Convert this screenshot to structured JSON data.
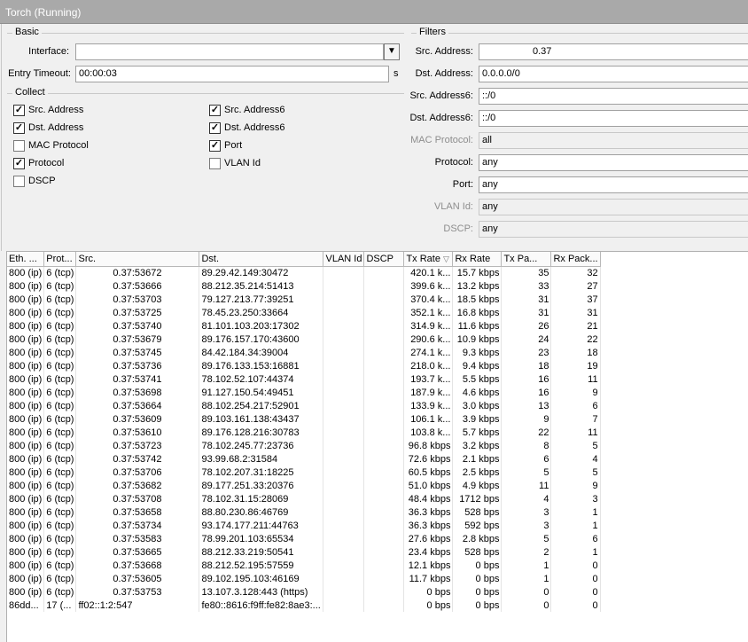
{
  "window": {
    "title": "Torch (Running)"
  },
  "basic": {
    "title": "Basic",
    "interface_label": "Interface:",
    "interface_value": "",
    "entry_timeout_label": "Entry Timeout:",
    "entry_timeout_value": "00:00:03",
    "entry_timeout_unit": "s"
  },
  "collect": {
    "title": "Collect",
    "items": [
      {
        "label": "Src. Address",
        "checked": true
      },
      {
        "label": "Src. Address6",
        "checked": true
      },
      {
        "label": "Dst. Address",
        "checked": true
      },
      {
        "label": "Dst. Address6",
        "checked": true
      },
      {
        "label": "MAC Protocol",
        "checked": false
      },
      {
        "label": "Port",
        "checked": true
      },
      {
        "label": "Protocol",
        "checked": true
      },
      {
        "label": "VLAN Id",
        "checked": false
      },
      {
        "label": "DSCP",
        "checked": false
      }
    ]
  },
  "filters": {
    "title": "Filters",
    "src_address_label": "Src. Address:",
    "src_address_value": "0.37",
    "dst_address_label": "Dst. Address:",
    "dst_address_value": "0.0.0.0/0",
    "src_address6_label": "Src. Address6:",
    "src_address6_value": "::/0",
    "dst_address6_label": "Dst. Address6:",
    "dst_address6_value": "::/0",
    "mac_protocol_label": "MAC Protocol:",
    "mac_protocol_value": "all",
    "protocol_label": "Protocol:",
    "protocol_value": "any",
    "port_label": "Port:",
    "port_value": "any",
    "vlan_id_label": "VLAN Id:",
    "vlan_id_value": "any",
    "dscp_label": "DSCP:",
    "dscp_value": "any"
  },
  "table": {
    "columns": [
      "Eth. ...",
      "Prot...",
      "Src.",
      "Dst.",
      "VLAN Id",
      "DSCP",
      "Tx Rate",
      "Rx Rate",
      "Tx Pa...",
      "Rx Pack..."
    ],
    "sort_icon": "sort-desc-icon",
    "rows": [
      [
        "800 (ip)",
        "6 (tcp)",
        "0.37:53672",
        "89.29.42.149:30472",
        "",
        "",
        "420.1 k...",
        "15.7 kbps",
        "35",
        "32"
      ],
      [
        "800 (ip)",
        "6 (tcp)",
        "0.37:53666",
        "88.212.35.214:51413",
        "",
        "",
        "399.6 k...",
        "13.2 kbps",
        "33",
        "27"
      ],
      [
        "800 (ip)",
        "6 (tcp)",
        "0.37:53703",
        "79.127.213.77:39251",
        "",
        "",
        "370.4 k...",
        "18.5 kbps",
        "31",
        "37"
      ],
      [
        "800 (ip)",
        "6 (tcp)",
        "0.37:53725",
        "78.45.23.250:33664",
        "",
        "",
        "352.1 k...",
        "16.8 kbps",
        "31",
        "31"
      ],
      [
        "800 (ip)",
        "6 (tcp)",
        "0.37:53740",
        "81.101.103.203:17302",
        "",
        "",
        "314.9 k...",
        "11.6 kbps",
        "26",
        "21"
      ],
      [
        "800 (ip)",
        "6 (tcp)",
        "0.37:53679",
        "89.176.157.170:43600",
        "",
        "",
        "290.6 k...",
        "10.9 kbps",
        "24",
        "22"
      ],
      [
        "800 (ip)",
        "6 (tcp)",
        "0.37:53745",
        "84.42.184.34:39004",
        "",
        "",
        "274.1 k...",
        "9.3 kbps",
        "23",
        "18"
      ],
      [
        "800 (ip)",
        "6 (tcp)",
        "0.37:53736",
        "89.176.133.153:16881",
        "",
        "",
        "218.0 k...",
        "9.4 kbps",
        "18",
        "19"
      ],
      [
        "800 (ip)",
        "6 (tcp)",
        "0.37:53741",
        "78.102.52.107:44374",
        "",
        "",
        "193.7 k...",
        "5.5 kbps",
        "16",
        "11"
      ],
      [
        "800 (ip)",
        "6 (tcp)",
        "0.37:53698",
        "91.127.150.54:49451",
        "",
        "",
        "187.9 k...",
        "4.6 kbps",
        "16",
        "9"
      ],
      [
        "800 (ip)",
        "6 (tcp)",
        "0.37:53664",
        "88.102.254.217:52901",
        "",
        "",
        "133.9 k...",
        "3.0 kbps",
        "13",
        "6"
      ],
      [
        "800 (ip)",
        "6 (tcp)",
        "0.37:53609",
        "89.103.161.138:43437",
        "",
        "",
        "106.1 k...",
        "3.9 kbps",
        "9",
        "7"
      ],
      [
        "800 (ip)",
        "6 (tcp)",
        "0.37:53610",
        "89.176.128.216:30783",
        "",
        "",
        "103.8 k...",
        "5.7 kbps",
        "22",
        "11"
      ],
      [
        "800 (ip)",
        "6 (tcp)",
        "0.37:53723",
        "78.102.245.77:23736",
        "",
        "",
        "96.8 kbps",
        "3.2 kbps",
        "8",
        "5"
      ],
      [
        "800 (ip)",
        "6 (tcp)",
        "0.37:53742",
        "93.99.68.2:31584",
        "",
        "",
        "72.6 kbps",
        "2.1 kbps",
        "6",
        "4"
      ],
      [
        "800 (ip)",
        "6 (tcp)",
        "0.37:53706",
        "78.102.207.31:18225",
        "",
        "",
        "60.5 kbps",
        "2.5 kbps",
        "5",
        "5"
      ],
      [
        "800 (ip)",
        "6 (tcp)",
        "0.37:53682",
        "89.177.251.33:20376",
        "",
        "",
        "51.0 kbps",
        "4.9 kbps",
        "11",
        "9"
      ],
      [
        "800 (ip)",
        "6 (tcp)",
        "0.37:53708",
        "78.102.31.15:28069",
        "",
        "",
        "48.4 kbps",
        "1712 bps",
        "4",
        "3"
      ],
      [
        "800 (ip)",
        "6 (tcp)",
        "0.37:53658",
        "88.80.230.86:46769",
        "",
        "",
        "36.3 kbps",
        "528 bps",
        "3",
        "1"
      ],
      [
        "800 (ip)",
        "6 (tcp)",
        "0.37:53734",
        "93.174.177.211:44763",
        "",
        "",
        "36.3 kbps",
        "592 bps",
        "3",
        "1"
      ],
      [
        "800 (ip)",
        "6 (tcp)",
        "0.37:53583",
        "78.99.201.103:65534",
        "",
        "",
        "27.6 kbps",
        "2.8 kbps",
        "5",
        "6"
      ],
      [
        "800 (ip)",
        "6 (tcp)",
        "0.37:53665",
        "88.212.33.219:50541",
        "",
        "",
        "23.4 kbps",
        "528 bps",
        "2",
        "1"
      ],
      [
        "800 (ip)",
        "6 (tcp)",
        "0.37:53668",
        "88.212.52.195:57559",
        "",
        "",
        "12.1 kbps",
        "0 bps",
        "1",
        "0"
      ],
      [
        "800 (ip)",
        "6 (tcp)",
        "0.37:53605",
        "89.102.195.103:46169",
        "",
        "",
        "11.7 kbps",
        "0 bps",
        "1",
        "0"
      ],
      [
        "800 (ip)",
        "6 (tcp)",
        "0.37:53753",
        "13.107.3.128:443 (https)",
        "",
        "",
        "0 bps",
        "0 bps",
        "0",
        "0"
      ],
      [
        "86dd...",
        "17 (...",
        "ff02::1:2:547",
        "fe80::8616:f9ff:fe82:8ae3:...",
        "",
        "",
        "0 bps",
        "0 bps",
        "0",
        "0"
      ]
    ]
  }
}
